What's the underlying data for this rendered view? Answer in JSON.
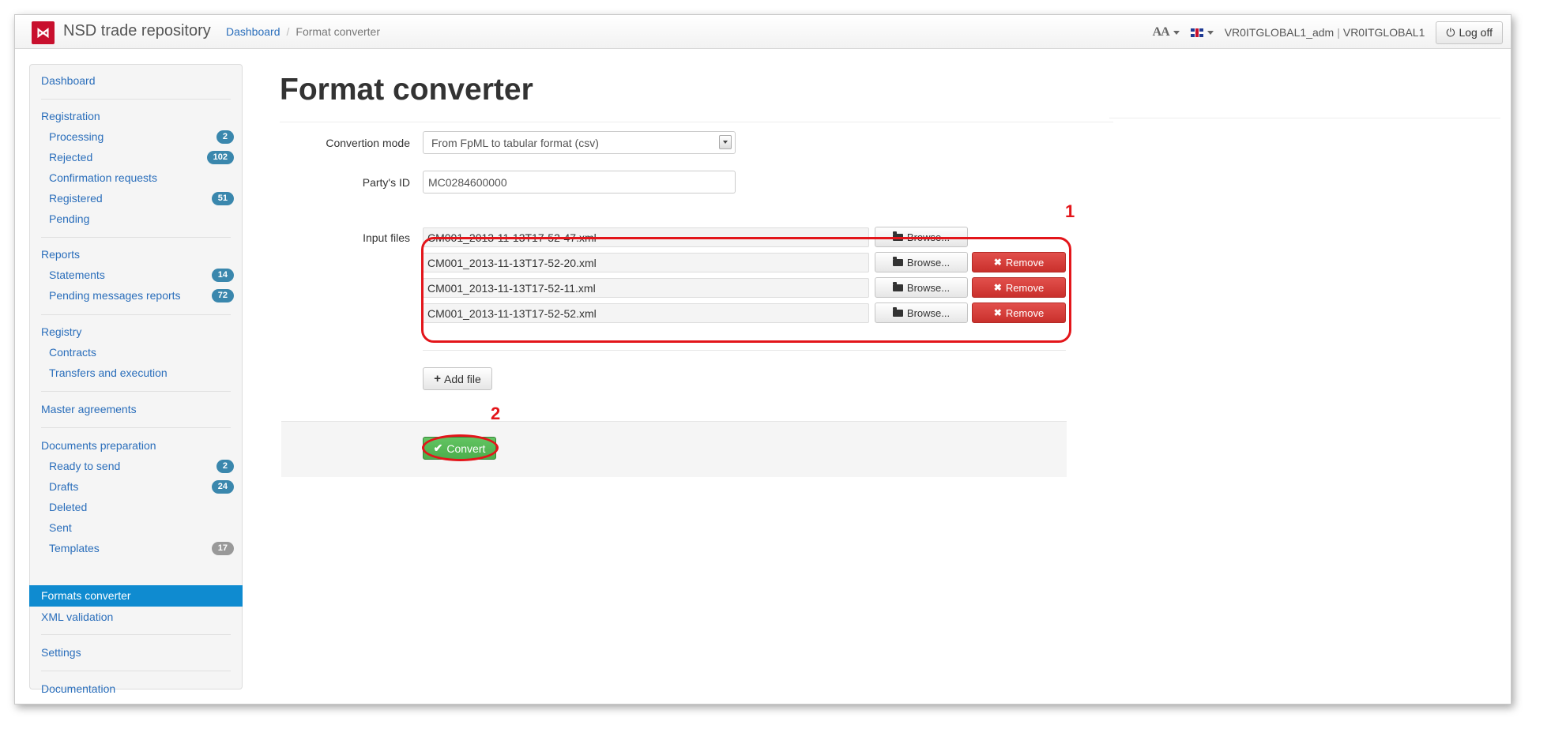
{
  "header": {
    "brand": "NSD trade repository",
    "logo_glyph": "⋈",
    "breadcrumb": {
      "home": "Dashboard",
      "current": "Format converter"
    },
    "font_tool": "AA",
    "user": {
      "login": "VR0ITGLOBAL1_adm",
      "org": "VR0ITGLOBAL1"
    },
    "logoff_label": "Log off"
  },
  "sidebar": {
    "dashboard": "Dashboard",
    "registration": {
      "title": "Registration",
      "items": [
        {
          "label": "Processing",
          "badge": "2"
        },
        {
          "label": "Rejected",
          "badge": "102"
        },
        {
          "label": "Confirmation requests",
          "badge": ""
        },
        {
          "label": "Registered",
          "badge": "51"
        },
        {
          "label": "Pending",
          "badge": ""
        }
      ]
    },
    "reports": {
      "title": "Reports",
      "items": [
        {
          "label": "Statements",
          "badge": "14"
        },
        {
          "label": "Pending messages reports",
          "badge": "72"
        }
      ]
    },
    "registry": {
      "title": "Registry",
      "items": [
        {
          "label": "Contracts"
        },
        {
          "label": "Transfers and execution"
        }
      ]
    },
    "master_agreements": "Master agreements",
    "documents": {
      "title": "Documents preparation",
      "items": [
        {
          "label": "Ready to send",
          "badge": "2"
        },
        {
          "label": "Drafts",
          "badge": "24"
        },
        {
          "label": "Deleted",
          "badge": ""
        },
        {
          "label": "Sent",
          "badge": ""
        },
        {
          "label": "Templates",
          "badge": "17"
        }
      ]
    },
    "formats_converter": "Formats converter",
    "xml_validation": "XML validation",
    "settings": "Settings",
    "documentation": "Documentation"
  },
  "main": {
    "title": "Format converter",
    "conversion_mode": {
      "label": "Convertion mode",
      "value": "From FpML to tabular format (csv)"
    },
    "party_id": {
      "label": "Party's ID",
      "value": "MC0284600000"
    },
    "input_files": {
      "label": "Input files",
      "browse_label": "Browse...",
      "remove_label": "Remove",
      "files": [
        "CM001_2013-11-13T17-52-47.xml",
        "CM001_2013-11-13T17-52-20.xml",
        "CM001_2013-11-13T17-52-11.xml",
        "CM001_2013-11-13T17-52-52.xml"
      ]
    },
    "add_file_label": "Add file",
    "convert_label": "Convert"
  },
  "callouts": {
    "files": "1",
    "convert": "2"
  }
}
